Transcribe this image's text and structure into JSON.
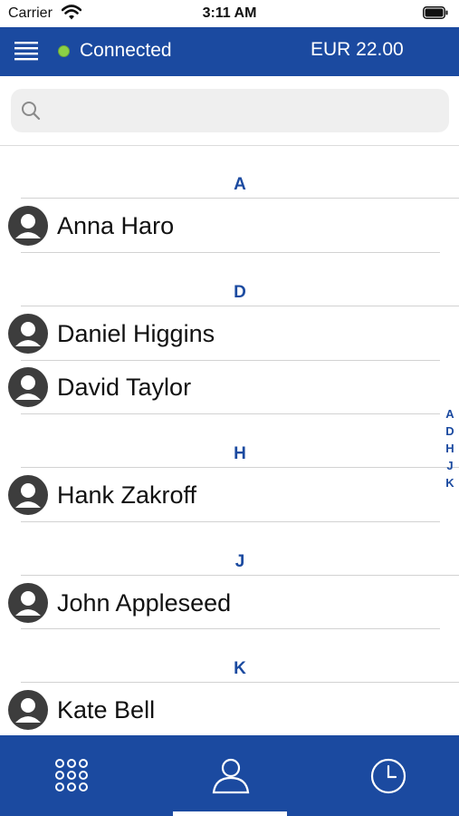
{
  "status_bar": {
    "carrier": "Carrier",
    "time": "3:11 AM"
  },
  "header": {
    "connection_status": "Connected",
    "balance": "EUR 22.00",
    "status_color": "#8bd146",
    "brand_color": "#1b4aa0"
  },
  "search": {
    "placeholder": "",
    "value": ""
  },
  "sections": [
    {
      "letter": "A",
      "contacts": [
        "Anna Haro"
      ]
    },
    {
      "letter": "D",
      "contacts": [
        "Daniel Higgins",
        "David Taylor"
      ]
    },
    {
      "letter": "H",
      "contacts": [
        "Hank Zakroff"
      ]
    },
    {
      "letter": "J",
      "contacts": [
        "John Appleseed"
      ]
    },
    {
      "letter": "K",
      "contacts": [
        "Kate Bell"
      ]
    }
  ],
  "index": [
    "A",
    "D",
    "H",
    "J",
    "K"
  ],
  "tabs": [
    {
      "icon": "keypad-icon",
      "active": false
    },
    {
      "icon": "contacts-icon",
      "active": true
    },
    {
      "icon": "recents-clock-icon",
      "active": false
    }
  ]
}
